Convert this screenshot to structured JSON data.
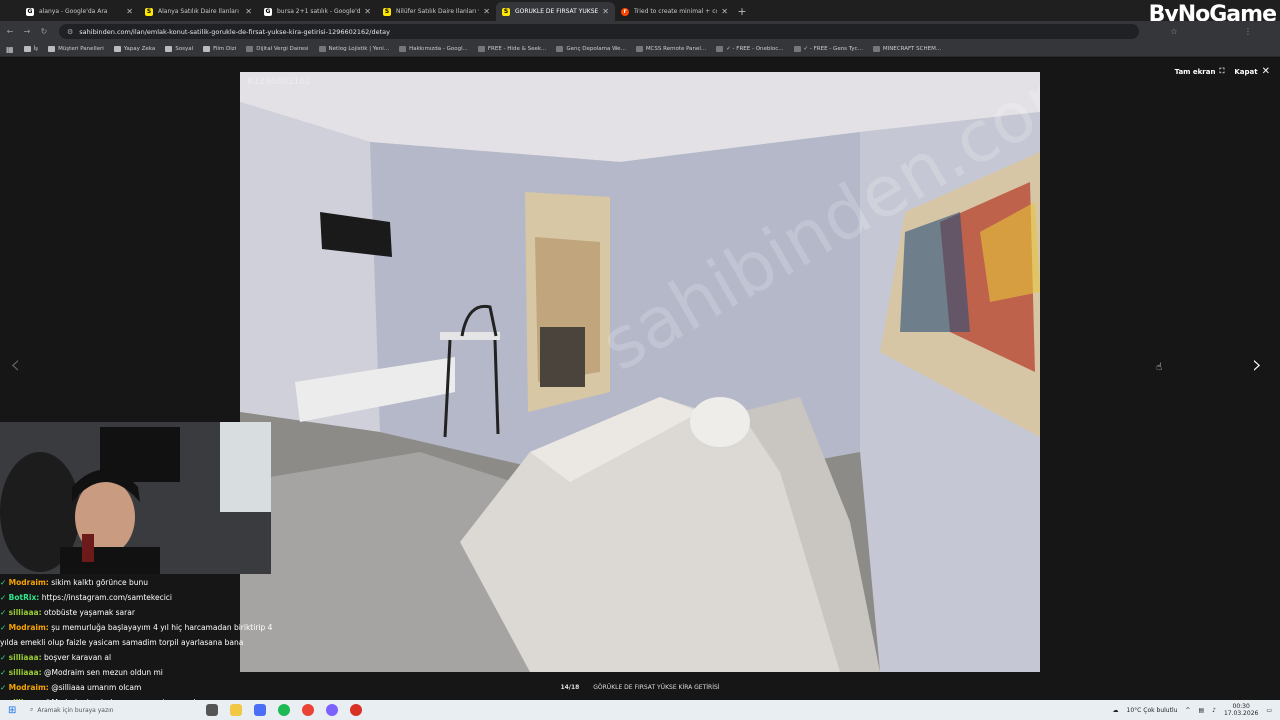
{
  "browser": {
    "tabs": [
      {
        "title": "alanya - Google'da Ara",
        "favicon_color": "#ffffff",
        "favicon_text": "G"
      },
      {
        "title": "Alanya Satılık Daire İlanları ve",
        "favicon_color": "#ffe800",
        "favicon_text": "S"
      },
      {
        "title": "bursa 2+1 satılık - Google'da A",
        "favicon_color": "#ffffff",
        "favicon_text": "G"
      },
      {
        "title": "Nilüfer Satılık Daire İlanları ve",
        "favicon_color": "#ffe800",
        "favicon_text": "S"
      },
      {
        "title": "GÖRÜKLE DE FIRSAT YÜKSE KİR",
        "favicon_color": "#ffe800",
        "favicon_text": "S"
      },
      {
        "title": "Tried to create minimal + cozy",
        "favicon_color": "#ff4500",
        "favicon_text": "r"
      }
    ],
    "new_tab": "+",
    "url": "sahibinden.com/ilan/emlak-konut-satilik-gorukle-de-firsat-yukse-kira-getirisi-1296602162/detay",
    "bookmarks": [
      {
        "label": "İş",
        "icon": "folder-icon"
      },
      {
        "label": "Müşteri Panelleri",
        "icon": "folder-icon"
      },
      {
        "label": "Yapay Zeka",
        "icon": "folder-icon"
      },
      {
        "label": "Sosyal",
        "icon": "folder-icon"
      },
      {
        "label": "Film Dizi",
        "icon": "folder-icon"
      },
      {
        "label": "Dijital Vergi Dairesi",
        "icon": "site-icon"
      },
      {
        "label": "Netlog Lojistik | Yeni...",
        "icon": "site-icon"
      },
      {
        "label": "Hakkımızda - Googl...",
        "icon": "site-icon"
      },
      {
        "label": "FREE - Hide & Seek...",
        "icon": "site-icon"
      },
      {
        "label": "Genç Depolama We...",
        "icon": "site-icon"
      },
      {
        "label": "MCSS Remote Panel...",
        "icon": "site-icon"
      },
      {
        "label": "✓ - FREE - Onebloc...",
        "icon": "site-icon"
      },
      {
        "label": "✓ - FREE - Gens Tyc...",
        "icon": "site-icon"
      },
      {
        "label": "MINECRAFT SCHEM...",
        "icon": "site-icon"
      }
    ]
  },
  "viewer": {
    "watermark_id": "#1296602162",
    "fullscreen_label": "Tam ekran",
    "close_label": "Kapat",
    "counter": "14/18",
    "title": "GÖRÜKLE DE FIRSAT YÜKSE KİRA GETİRİSİ",
    "watermark": "sahibinden.com"
  },
  "logo": "ByNoGame",
  "chat": [
    {
      "user": "Modraim:",
      "message": "sikim kalktı görünce bunu",
      "color": "#f7a300"
    },
    {
      "user": "BotRix:",
      "message": "https://instagram.com/samtekecici",
      "color": "#2ee58c"
    },
    {
      "user": "silliaaa:",
      "message": "otobüste yaşamak sarar",
      "color": "#9acd32"
    },
    {
      "user": "Modraim:",
      "message": "şu memurluğa başlayayım 4 yıl hiç harcamadan biriktirip 4",
      "color": "#f7a300"
    },
    {
      "user": "",
      "message": "yılda emekli olup faizle yasicam samadim torpil ayarlasana bana",
      "color": "#ffffff"
    },
    {
      "user": "silliaaa:",
      "message": "boşver karavan al",
      "color": "#9acd32"
    },
    {
      "user": "silliaaa:",
      "message": "@Modraim sen mezun oldun mi",
      "color": "#9acd32"
    },
    {
      "user": "Modraim:",
      "message": "@silliaaa umarım olcam",
      "color": "#f7a300"
    },
    {
      "user": "silliaaa:",
      "message": "@Modraim benimle aynı sene atanma olur mu",
      "color": "#9acd32"
    }
  ],
  "taskbar": {
    "search_placeholder": "Aramak için buraya yazın",
    "weather": "10°C  Çok bulutlu",
    "time": "00:30",
    "date": "17.03.2026"
  }
}
